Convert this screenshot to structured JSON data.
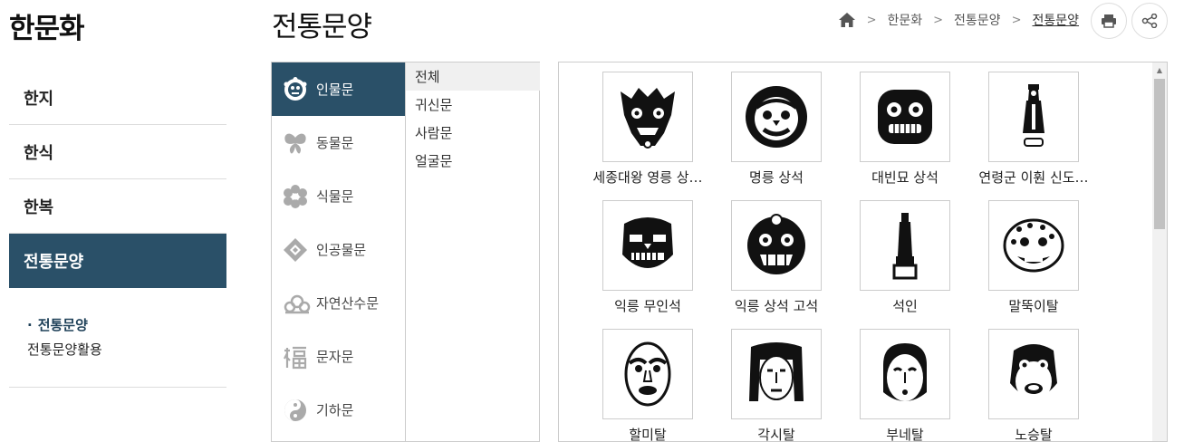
{
  "sidebar": {
    "title": "한문화",
    "menu": [
      {
        "label": "한지"
      },
      {
        "label": "한식"
      },
      {
        "label": "한복"
      },
      {
        "label": "전통문양"
      }
    ],
    "sub": [
      {
        "bullet": "·",
        "label": "전통문양"
      },
      {
        "label": "전통문양활용"
      }
    ]
  },
  "header": {
    "title": "전통문양",
    "breadcrumb": [
      "한문화",
      "전통문양",
      "전통문양"
    ],
    "home_icon": "home-icon",
    "print_icon": "print-icon",
    "share_icon": "share-icon"
  },
  "categories": [
    {
      "label": "인물문",
      "icon": "face-icon"
    },
    {
      "label": "동물문",
      "icon": "butterfly-icon"
    },
    {
      "label": "식물문",
      "icon": "flower-icon"
    },
    {
      "label": "인공물문",
      "icon": "diamond-icon"
    },
    {
      "label": "자연산수문",
      "icon": "cloud-icon"
    },
    {
      "label": "문자문",
      "icon": "character-icon"
    },
    {
      "label": "기하문",
      "icon": "swirl-icon"
    }
  ],
  "subcategories": [
    {
      "label": "전체"
    },
    {
      "label": "귀신문"
    },
    {
      "label": "사람문"
    },
    {
      "label": "얼굴문"
    }
  ],
  "items": [
    {
      "caption": "세종대왕 영릉 상…"
    },
    {
      "caption": "명릉 상석"
    },
    {
      "caption": "대빈묘 상석"
    },
    {
      "caption": "연령군 이훤 신도…"
    },
    {
      "caption": "익릉 무인석"
    },
    {
      "caption": "익릉 상석 고석"
    },
    {
      "caption": "석인"
    },
    {
      "caption": "말뚝이탈"
    },
    {
      "caption": "할미탈"
    },
    {
      "caption": "각시탈"
    },
    {
      "caption": "부네탈"
    },
    {
      "caption": "노승탈"
    }
  ],
  "colors": {
    "accent": "#2a5068",
    "border": "#cccccc"
  }
}
